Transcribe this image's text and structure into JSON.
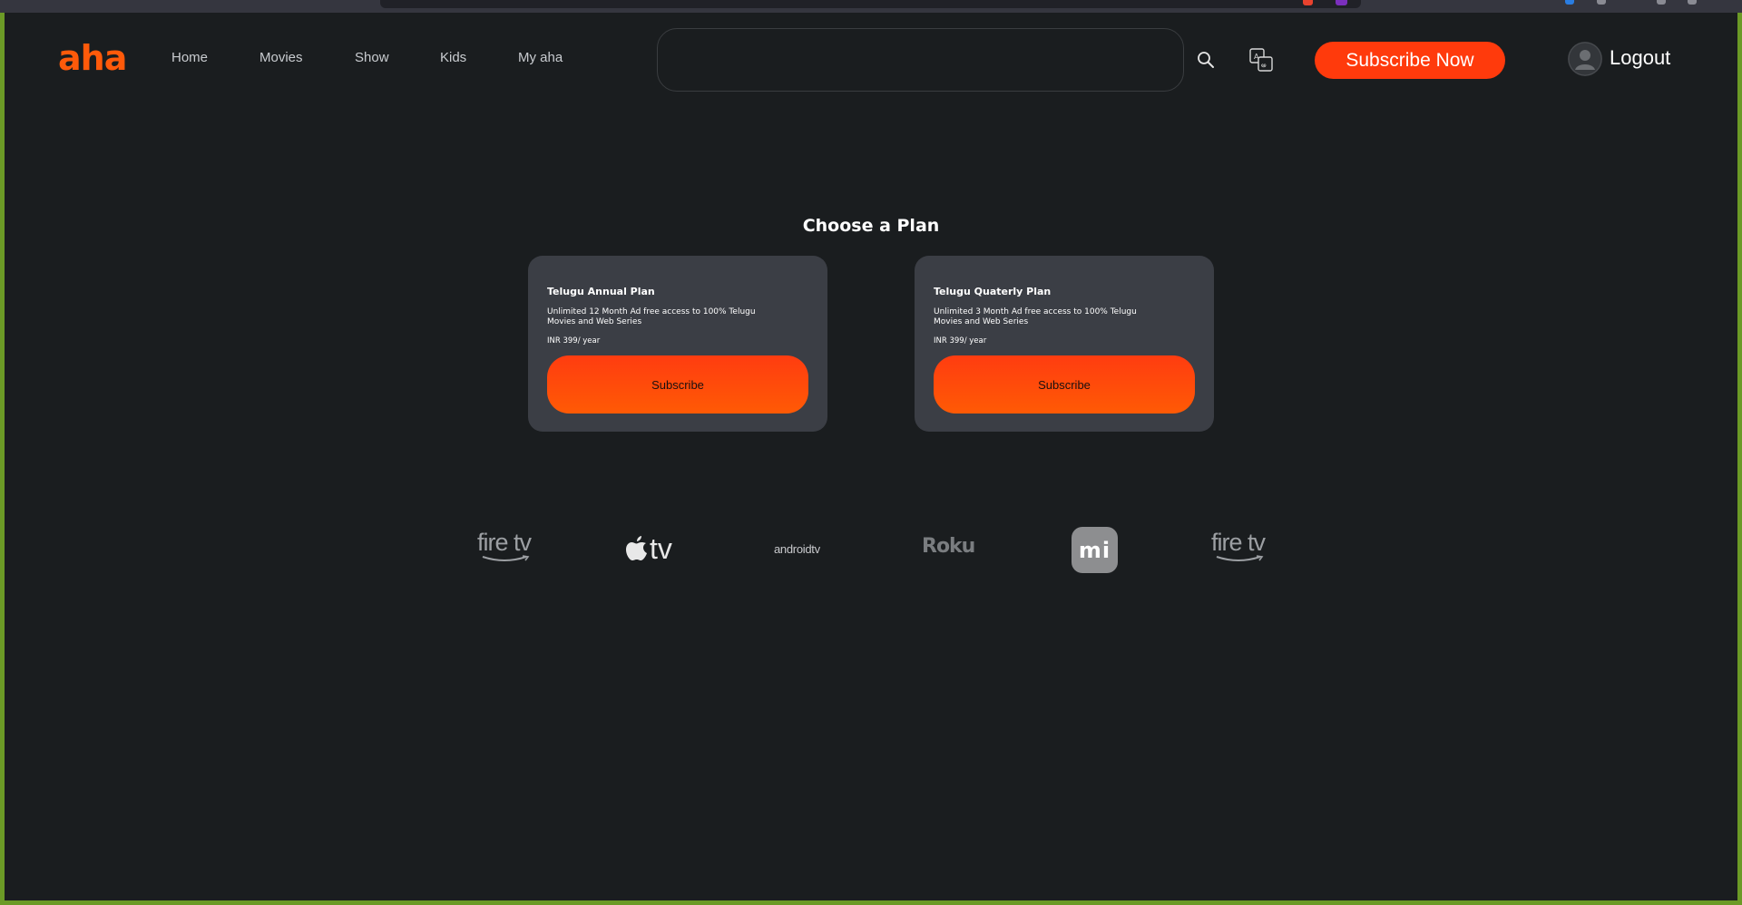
{
  "header": {
    "logo_text": "aha",
    "nav": [
      "Home",
      "Movies",
      "Show",
      "Kids",
      "My aha"
    ],
    "search": {
      "value": "",
      "placeholder": ""
    },
    "subscribe_now_label": "Subscribe Now",
    "logout_label": "Logout"
  },
  "main": {
    "title": "Choose a Plan",
    "plans": [
      {
        "name": "Telugu Annual Plan",
        "description": "Unlimited 12 Month Ad free access to 100% Telugu Movies and Web Series",
        "price": "INR 399/ year",
        "button_label": "Subscribe"
      },
      {
        "name": "Telugu Quaterly Plan",
        "description": "Unlimited 3 Month Ad free access to 100% Telugu Movies and Web Series",
        "price": "INR 399/ year",
        "button_label": "Subscribe"
      }
    ]
  },
  "devices": [
    {
      "label": "fire tv",
      "icon": "fire-tv-logo"
    },
    {
      "label": "tv",
      "icon": "apple-tv-logo"
    },
    {
      "label": "androidtv",
      "icon": "android-tv-logo"
    },
    {
      "label": "Roku",
      "icon": "roku-logo"
    },
    {
      "label": "mi",
      "icon": "xiaomi-logo"
    },
    {
      "label": "fire tv",
      "icon": "fire-tv-logo"
    }
  ],
  "colors": {
    "brand_orange": "#ff5a0a",
    "accent_button": "#ff3a0c",
    "background": "#1a1d1f",
    "card": "#3b3e45"
  }
}
